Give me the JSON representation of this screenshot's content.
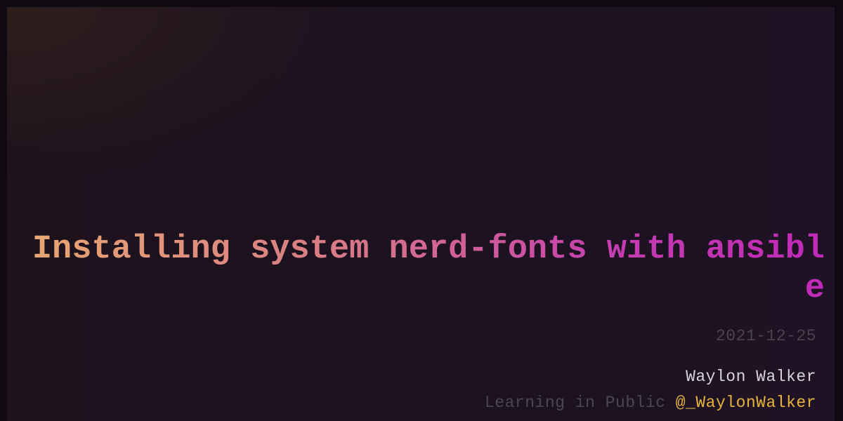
{
  "post": {
    "title": "Installing system nerd-fonts with ansible",
    "date": "2021-12-25",
    "author": "Waylon Walker",
    "tagline": "Learning in Public",
    "handle": "@_WaylonWalker"
  },
  "colors": {
    "background": "#1d1220",
    "title_gradient_start": "#e8a872",
    "title_gradient_end": "#c02ab8",
    "date": "#4a4350",
    "author": "#d8d4dc",
    "tagline": "#4c4552",
    "handle": "#e6b43c"
  }
}
